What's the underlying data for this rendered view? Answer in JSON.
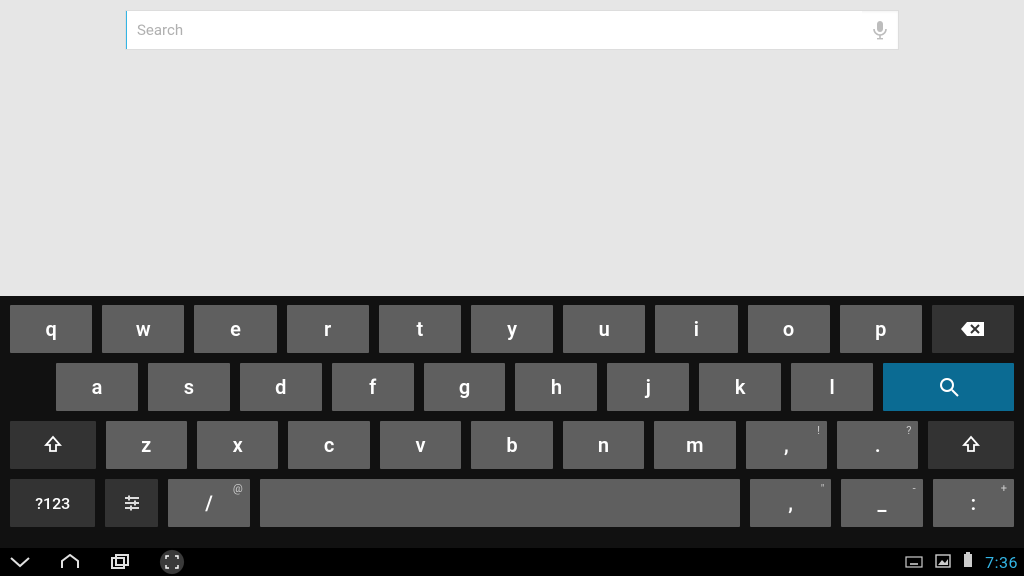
{
  "search": {
    "placeholder": "Search",
    "value": ""
  },
  "keyboard": {
    "row1": [
      "q",
      "w",
      "e",
      "r",
      "t",
      "y",
      "u",
      "i",
      "o",
      "p"
    ],
    "row2": [
      "a",
      "s",
      "d",
      "f",
      "g",
      "h",
      "j",
      "k",
      "l"
    ],
    "row3": [
      "z",
      "x",
      "c",
      "v",
      "b",
      "n",
      "m"
    ],
    "row3_punct": [
      {
        "main": ",",
        "sup": "!"
      },
      {
        "main": ".",
        "sup": "?"
      }
    ],
    "row4": {
      "mode": "?123",
      "slash": "/",
      "slash_sup": "@",
      "p1": ",",
      "p1_sup": "\"",
      "p2": "_",
      "p2_sup": "-",
      "p3": ":",
      "p3_sup": "+"
    }
  },
  "statusbar": {
    "time": "7:36"
  },
  "icons": {
    "mic": "mic-icon",
    "backspace": "backspace-icon",
    "search": "search-icon",
    "shift": "shift-icon",
    "settings": "settings-icon",
    "back_down": "nav-back-down-icon",
    "home": "nav-home-icon",
    "recents": "nav-recents-icon",
    "screenshot": "nav-screenshot-icon",
    "ime": "ime-switch-icon",
    "picture": "picture-status-icon",
    "battery": "battery-status-icon"
  }
}
